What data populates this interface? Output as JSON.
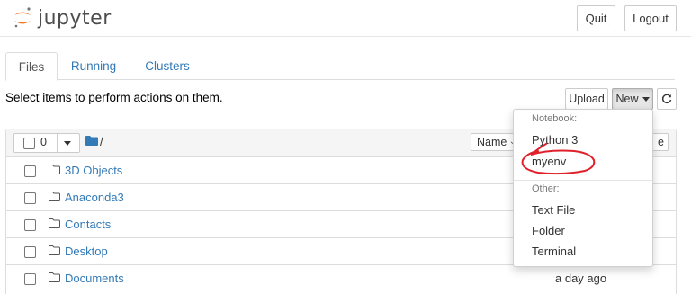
{
  "app": {
    "logo_text": "jupyter"
  },
  "header": {
    "quit_label": "Quit",
    "logout_label": "Logout"
  },
  "tabs": [
    {
      "label": "Files",
      "active": true
    },
    {
      "label": "Running",
      "active": false
    },
    {
      "label": "Clusters",
      "active": false
    }
  ],
  "toolbar": {
    "instructions": "Select items to perform actions on them.",
    "upload_label": "Upload",
    "new_label": "New"
  },
  "list": {
    "selected_count": "0",
    "path_separator": "/",
    "sort_label": "Name",
    "sort_tail_label": "e",
    "rows": [
      {
        "name": "3D Objects",
        "modified": ""
      },
      {
        "name": "Anaconda3",
        "modified": ""
      },
      {
        "name": "Contacts",
        "modified": ""
      },
      {
        "name": "Desktop",
        "modified": ""
      },
      {
        "name": "Documents",
        "modified": "a day ago"
      }
    ]
  },
  "new_menu": {
    "notebook_header": "Notebook:",
    "notebook_items": [
      "Python 3",
      "myenv"
    ],
    "other_header": "Other:",
    "other_items": [
      "Text File",
      "Folder",
      "Terminal"
    ]
  },
  "colors": {
    "link": "#337ab7",
    "logo_orange": "#f37726",
    "annotation_red": "#e0202a"
  },
  "icons": {
    "folder": "folder-icon",
    "refresh": "refresh-icon",
    "sort": "arrow-down-icon"
  }
}
